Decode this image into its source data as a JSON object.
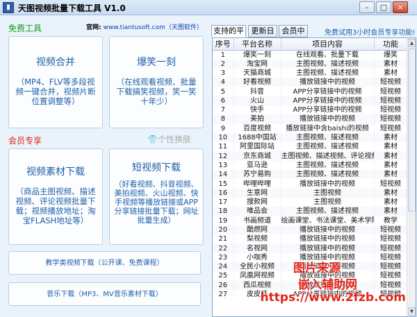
{
  "window": {
    "title": "天图视频批量下载工具 V1.0",
    "min": "–",
    "max": "□",
    "close": "×"
  },
  "left": {
    "free_title": "免费工具",
    "site_label": "官网:",
    "site_url": "www.tiantusoft.com（天图软件）",
    "member_title": "会员专享",
    "skin_label": "个性换肤",
    "buttons": {
      "merge": {
        "title": "视频合并",
        "desc": "（MP4、FLV等多段视频一键合并，视频片断位置调整等）"
      },
      "funny": {
        "title": "爆笑一刻",
        "desc": "（在线观看视频、批量下载搞笑视频，笑一笑十年少）"
      },
      "material": {
        "title": "视频素材下载",
        "desc": "（商品主图视频、描述视频、评论视频批量下载；视频播放地址；淘宝FLASH地址等）"
      },
      "short": {
        "title": "短视频下载",
        "desc": "（好看视频、抖音视频、美拍视频、火山视频、快手视频等播放链接或APP分享链接批量下载；网址批量生成）"
      },
      "teaching": "教学类视频下载（公开课、免费课程）",
      "music": "音乐下载（MP3、MV音乐素材下载）"
    }
  },
  "right": {
    "tabs": [
      "支持的平台",
      "更新日志",
      "会员中心"
    ],
    "promo": "免费试用3小时会员专享功能!",
    "columns": [
      "序号",
      "平台名称",
      "项目内容",
      "功能"
    ],
    "rows": [
      [
        "1",
        "爆笑一刻",
        "在线观看、批量下载",
        "爆笑"
      ],
      [
        "2",
        "淘宝网",
        "主图视频、描述视频",
        "素材"
      ],
      [
        "3",
        "天猫商城",
        "主图视频、描述视频",
        "素材"
      ],
      [
        "4",
        "好看视频",
        "播放链接中的视频",
        "短视频"
      ],
      [
        "5",
        "抖音",
        "APP分享链接中的视频",
        "短视频"
      ],
      [
        "6",
        "火山",
        "APP分享链接中的视频",
        "短视频"
      ],
      [
        "7",
        "快手",
        "APP分享链接中的视频",
        "短视频"
      ],
      [
        "8",
        "美拍",
        "播放链接中的视频",
        "短视频"
      ],
      [
        "9",
        "百度视频",
        "播放链接中含baishi的视频",
        "短视频"
      ],
      [
        "10",
        "1688中国站",
        "主图视频、描述视频",
        "素材"
      ],
      [
        "11",
        "阿里国际站",
        "主图视频、描述视频",
        "素材"
      ],
      [
        "12",
        "京东商城",
        "主图视频、描述视频、评论视频",
        "素材"
      ],
      [
        "13",
        "亚马逊",
        "主图视频、描述视频",
        "素材"
      ],
      [
        "14",
        "苏宁易购",
        "主图视频、描述视频",
        "素材"
      ],
      [
        "15",
        "哔哩哔哩",
        "播放链接中的视频",
        "短视频"
      ],
      [
        "16",
        "生意网",
        "主图视频",
        "素材"
      ],
      [
        "17",
        "搜款网",
        "主图视频",
        "素材"
      ],
      [
        "18",
        "唯品会",
        "主图视频、描述视频",
        "素材"
      ],
      [
        "19",
        "书画频道",
        "绘画课堂、书法课堂、美术学院",
        "教学"
      ],
      [
        "20",
        "酷燃网",
        "播放链接中的视频",
        "短视频"
      ],
      [
        "21",
        "梨视频",
        "播放链接中的视频",
        "短视频"
      ],
      [
        "22",
        "名视网",
        "播放链接中的视频",
        "短视频"
      ],
      [
        "23",
        "小咖秀",
        "播放链接中的视频",
        "短视频"
      ],
      [
        "24",
        "全民小视频",
        "播放链接中的视频",
        "短视频"
      ],
      [
        "25",
        "凤凰网视频",
        "播放链接中的视频",
        "短视频"
      ],
      [
        "26",
        "西瓜视频",
        "播放链接中的视频",
        "短视频"
      ],
      [
        "27",
        "皮皮虾",
        "APP分享链接中的视频",
        "短视频"
      ]
    ]
  },
  "watermark": {
    "line1": "图片来源",
    "line2": "嵌入辅助网",
    "line3": "https://www.2fzb.com"
  },
  "colors": {
    "green": "#1a9a1a",
    "red": "#e1261c",
    "blue": "#1f5fa8"
  }
}
